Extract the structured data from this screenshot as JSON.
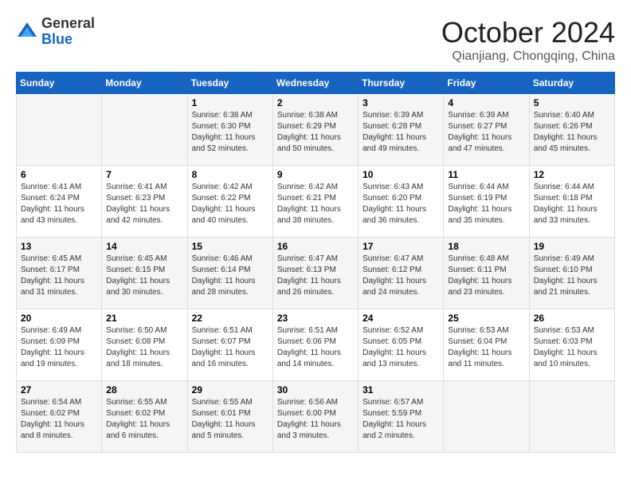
{
  "logo": {
    "general": "General",
    "blue": "Blue"
  },
  "header": {
    "month": "October 2024",
    "location": "Qianjiang, Chongqing, China"
  },
  "weekdays": [
    "Sunday",
    "Monday",
    "Tuesday",
    "Wednesday",
    "Thursday",
    "Friday",
    "Saturday"
  ],
  "weeks": [
    [
      {
        "day": "",
        "content": ""
      },
      {
        "day": "",
        "content": ""
      },
      {
        "day": "1",
        "content": "Sunrise: 6:38 AM\nSunset: 6:30 PM\nDaylight: 11 hours and 52 minutes."
      },
      {
        "day": "2",
        "content": "Sunrise: 6:38 AM\nSunset: 6:29 PM\nDaylight: 11 hours and 50 minutes."
      },
      {
        "day": "3",
        "content": "Sunrise: 6:39 AM\nSunset: 6:28 PM\nDaylight: 11 hours and 49 minutes."
      },
      {
        "day": "4",
        "content": "Sunrise: 6:39 AM\nSunset: 6:27 PM\nDaylight: 11 hours and 47 minutes."
      },
      {
        "day": "5",
        "content": "Sunrise: 6:40 AM\nSunset: 6:26 PM\nDaylight: 11 hours and 45 minutes."
      }
    ],
    [
      {
        "day": "6",
        "content": "Sunrise: 6:41 AM\nSunset: 6:24 PM\nDaylight: 11 hours and 43 minutes."
      },
      {
        "day": "7",
        "content": "Sunrise: 6:41 AM\nSunset: 6:23 PM\nDaylight: 11 hours and 42 minutes."
      },
      {
        "day": "8",
        "content": "Sunrise: 6:42 AM\nSunset: 6:22 PM\nDaylight: 11 hours and 40 minutes."
      },
      {
        "day": "9",
        "content": "Sunrise: 6:42 AM\nSunset: 6:21 PM\nDaylight: 11 hours and 38 minutes."
      },
      {
        "day": "10",
        "content": "Sunrise: 6:43 AM\nSunset: 6:20 PM\nDaylight: 11 hours and 36 minutes."
      },
      {
        "day": "11",
        "content": "Sunrise: 6:44 AM\nSunset: 6:19 PM\nDaylight: 11 hours and 35 minutes."
      },
      {
        "day": "12",
        "content": "Sunrise: 6:44 AM\nSunset: 6:18 PM\nDaylight: 11 hours and 33 minutes."
      }
    ],
    [
      {
        "day": "13",
        "content": "Sunrise: 6:45 AM\nSunset: 6:17 PM\nDaylight: 11 hours and 31 minutes."
      },
      {
        "day": "14",
        "content": "Sunrise: 6:45 AM\nSunset: 6:15 PM\nDaylight: 11 hours and 30 minutes."
      },
      {
        "day": "15",
        "content": "Sunrise: 6:46 AM\nSunset: 6:14 PM\nDaylight: 11 hours and 28 minutes."
      },
      {
        "day": "16",
        "content": "Sunrise: 6:47 AM\nSunset: 6:13 PM\nDaylight: 11 hours and 26 minutes."
      },
      {
        "day": "17",
        "content": "Sunrise: 6:47 AM\nSunset: 6:12 PM\nDaylight: 11 hours and 24 minutes."
      },
      {
        "day": "18",
        "content": "Sunrise: 6:48 AM\nSunset: 6:11 PM\nDaylight: 11 hours and 23 minutes."
      },
      {
        "day": "19",
        "content": "Sunrise: 6:49 AM\nSunset: 6:10 PM\nDaylight: 11 hours and 21 minutes."
      }
    ],
    [
      {
        "day": "20",
        "content": "Sunrise: 6:49 AM\nSunset: 6:09 PM\nDaylight: 11 hours and 19 minutes."
      },
      {
        "day": "21",
        "content": "Sunrise: 6:50 AM\nSunset: 6:08 PM\nDaylight: 11 hours and 18 minutes."
      },
      {
        "day": "22",
        "content": "Sunrise: 6:51 AM\nSunset: 6:07 PM\nDaylight: 11 hours and 16 minutes."
      },
      {
        "day": "23",
        "content": "Sunrise: 6:51 AM\nSunset: 6:06 PM\nDaylight: 11 hours and 14 minutes."
      },
      {
        "day": "24",
        "content": "Sunrise: 6:52 AM\nSunset: 6:05 PM\nDaylight: 11 hours and 13 minutes."
      },
      {
        "day": "25",
        "content": "Sunrise: 6:53 AM\nSunset: 6:04 PM\nDaylight: 11 hours and 11 minutes."
      },
      {
        "day": "26",
        "content": "Sunrise: 6:53 AM\nSunset: 6:03 PM\nDaylight: 11 hours and 10 minutes."
      }
    ],
    [
      {
        "day": "27",
        "content": "Sunrise: 6:54 AM\nSunset: 6:02 PM\nDaylight: 11 hours and 8 minutes."
      },
      {
        "day": "28",
        "content": "Sunrise: 6:55 AM\nSunset: 6:02 PM\nDaylight: 11 hours and 6 minutes."
      },
      {
        "day": "29",
        "content": "Sunrise: 6:55 AM\nSunset: 6:01 PM\nDaylight: 11 hours and 5 minutes."
      },
      {
        "day": "30",
        "content": "Sunrise: 6:56 AM\nSunset: 6:00 PM\nDaylight: 11 hours and 3 minutes."
      },
      {
        "day": "31",
        "content": "Sunrise: 6:57 AM\nSunset: 5:59 PM\nDaylight: 11 hours and 2 minutes."
      },
      {
        "day": "",
        "content": ""
      },
      {
        "day": "",
        "content": ""
      }
    ]
  ]
}
